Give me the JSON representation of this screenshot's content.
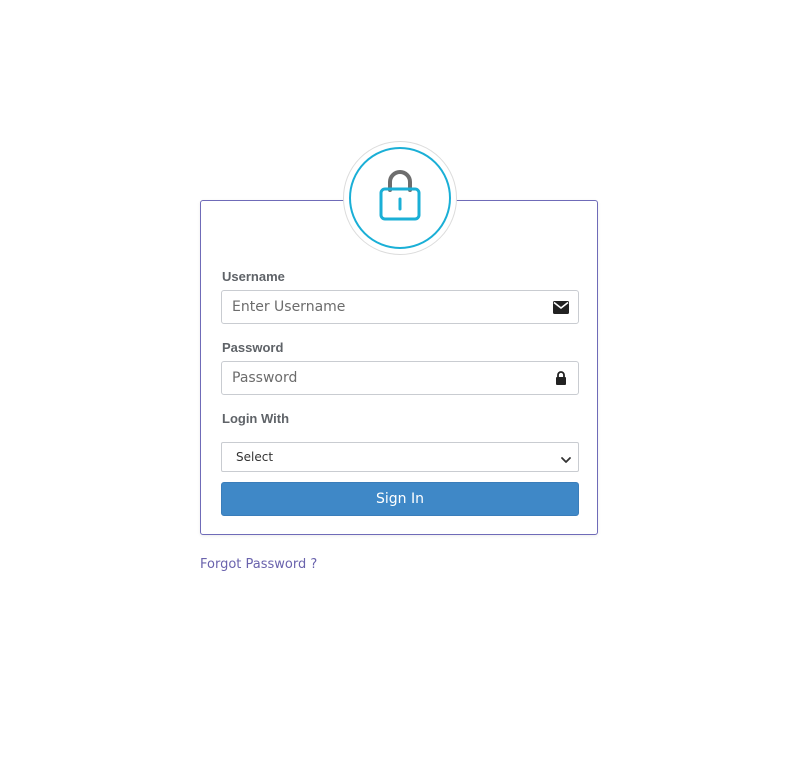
{
  "form": {
    "username_label": "Username",
    "username_placeholder": "Enter Username",
    "password_label": "Password",
    "password_placeholder": "Password",
    "login_with_label": "Login With",
    "login_with_selected": "Select",
    "sign_in_label": "Sign In",
    "forgot_password_label": "Forgot Password ?"
  },
  "icons": {
    "header": "lock-icon",
    "username": "envelope-icon",
    "password": "padlock-icon",
    "select": "chevron-down-icon"
  },
  "colors": {
    "card_border": "#6f6bb8",
    "lock_ring": "#1aafd6",
    "lock_shackle": "#6d6d6d",
    "button_bg": "#3f88c7",
    "link": "#6a63ad"
  }
}
